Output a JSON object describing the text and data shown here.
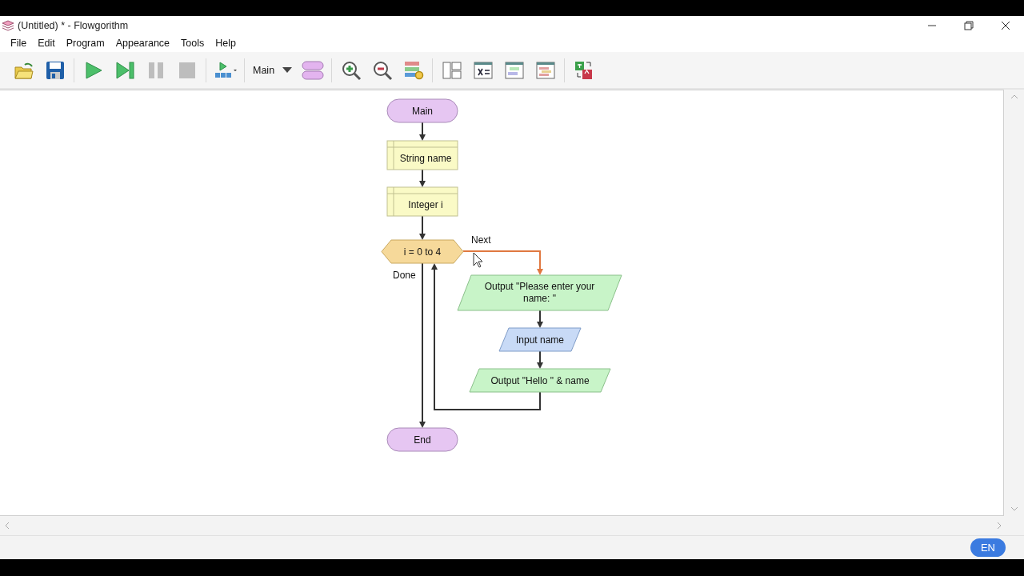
{
  "window": {
    "title": "(Untitled) * - Flowgorithm"
  },
  "menu": [
    "File",
    "Edit",
    "Program",
    "Appearance",
    "Tools",
    "Help"
  ],
  "toolbar": [
    {
      "kind": "open"
    },
    {
      "kind": "save"
    },
    {
      "kind": "sep"
    },
    {
      "kind": "run"
    },
    {
      "kind": "step"
    },
    {
      "kind": "pause"
    },
    {
      "kind": "stop"
    },
    {
      "kind": "sep"
    },
    {
      "kind": "layout-run"
    },
    {
      "kind": "sep"
    },
    {
      "kind": "function-select",
      "value": "Main"
    },
    {
      "kind": "functions"
    },
    {
      "kind": "sep"
    },
    {
      "kind": "zoom-in"
    },
    {
      "kind": "zoom-out"
    },
    {
      "kind": "styles"
    },
    {
      "kind": "sep"
    },
    {
      "kind": "layout"
    },
    {
      "kind": "variables"
    },
    {
      "kind": "console"
    },
    {
      "kind": "chart"
    },
    {
      "kind": "sep"
    },
    {
      "kind": "translate"
    }
  ],
  "flowchart": {
    "nodes": [
      {
        "kind": "terminal",
        "label": "Main"
      },
      {
        "kind": "declare",
        "label": "String name"
      },
      {
        "kind": "declare",
        "label": "Integer i"
      },
      {
        "kind": "for",
        "label": "i = 0 to 4"
      },
      {
        "kind": "output",
        "label": "Output \"Please enter your name: \""
      },
      {
        "kind": "input",
        "label": "Input name"
      },
      {
        "kind": "output",
        "label": "Output \"Hello \" & name"
      },
      {
        "kind": "terminal",
        "label": "End"
      }
    ],
    "loop_labels": {
      "next": "Next",
      "done": "Done"
    }
  },
  "status_bar": {
    "language": "EN"
  }
}
